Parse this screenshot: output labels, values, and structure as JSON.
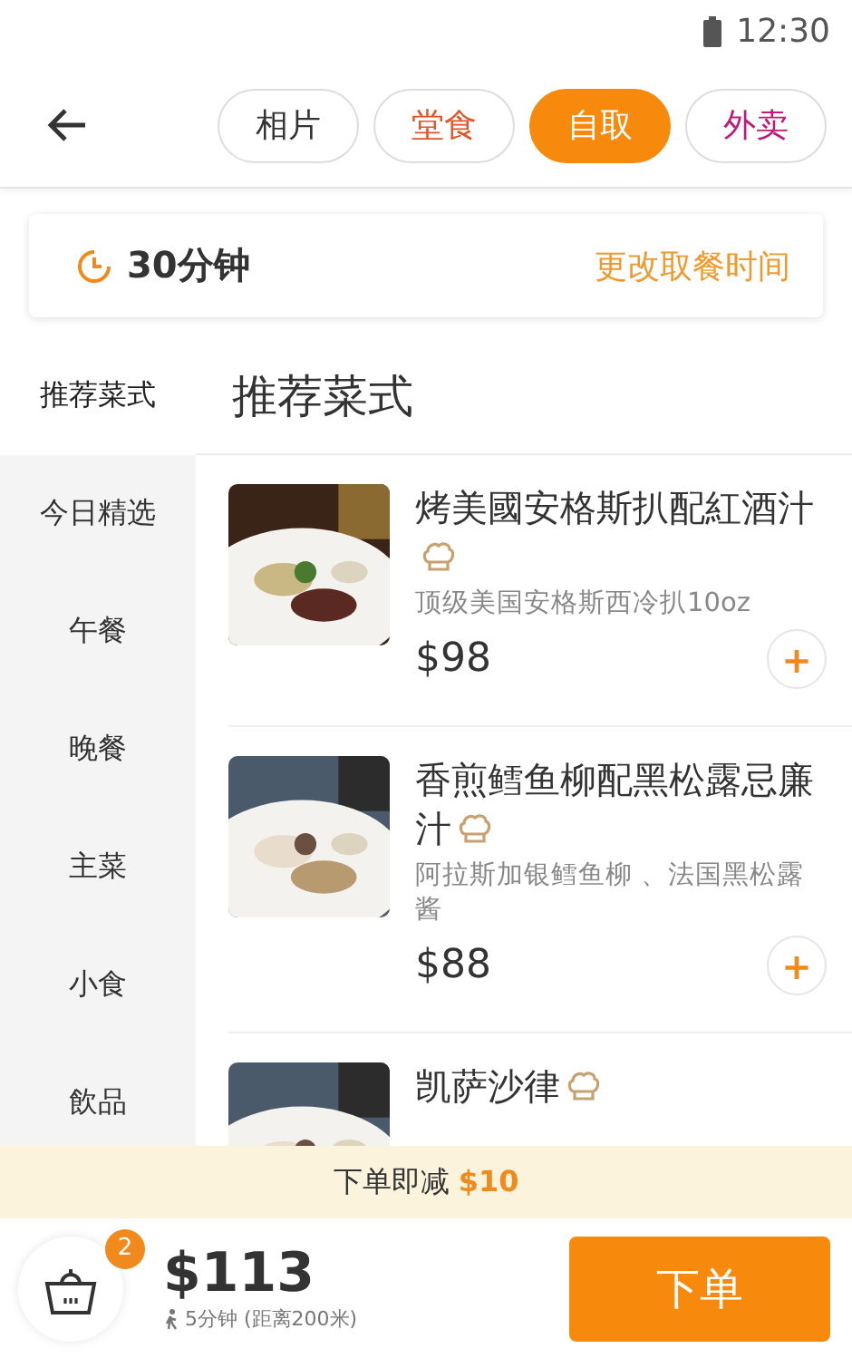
{
  "status_bar": {
    "time": "12:30"
  },
  "tabs": [
    {
      "label": "相片",
      "selected": false,
      "color": "#333333"
    },
    {
      "label": "堂食",
      "selected": false,
      "color": "#e0552a"
    },
    {
      "label": "自取",
      "selected": true,
      "color": "#f78a0d"
    },
    {
      "label": "外卖",
      "selected": false,
      "color": "#c2187a"
    }
  ],
  "pickup": {
    "duration": "30分钟",
    "change_link": "更改取餐时间"
  },
  "sidebar": {
    "items": [
      {
        "label": "推荐菜式",
        "selected": true
      },
      {
        "label": "今日精选",
        "selected": false
      },
      {
        "label": "午餐",
        "selected": false
      },
      {
        "label": "晚餐",
        "selected": false
      },
      {
        "label": "主菜",
        "selected": false
      },
      {
        "label": "小食",
        "selected": false
      },
      {
        "label": "飲品",
        "selected": false
      }
    ]
  },
  "section_title": "推荐菜式",
  "dishes": [
    {
      "name": "烤美國安格斯扒配紅酒汁",
      "description": "顶级美国安格斯西冷扒10oz",
      "price": "$98",
      "chef_special": true,
      "add_button": "+"
    },
    {
      "name": "香煎鳕鱼柳配黑松露忌廉汁",
      "description": "阿拉斯加银鳕鱼柳 、法国黑松露酱",
      "price": "$88",
      "chef_special": true,
      "add_button": "+"
    },
    {
      "name": "凯萨沙律",
      "chef_special": true
    }
  ],
  "promo": "下单即减 **$10**",
  "cart": {
    "count": "2",
    "total": "$113",
    "eta": "5分钟 (距离200米)",
    "checkout": "下单"
  }
}
